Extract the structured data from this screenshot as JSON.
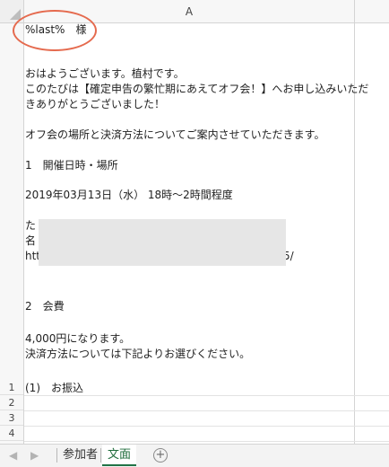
{
  "sheet": {
    "column_header": "A",
    "cell_lines": [
      "%last%　様",
      "おはようございます。植村です。",
      "このたびは【確定申告の繁忙期にあえてオフ会！】へお申し込みいただ",
      "きありがとうございました！",
      "オフ会の場所と決済方法についてご案内させていただきます。",
      "1　開催日時・場所",
      " 2019年03月13日（水） 18時～2時間程度",
      "た",
      "名",
      "htt",
      "5/",
      "2　会費",
      "4,000円になります。",
      "決済方法については下記よりお選びください。",
      "(1)　お振込"
    ],
    "row_numbers": [
      "1",
      "2",
      "3",
      "4"
    ]
  },
  "tabs": {
    "prev_icon": "◀",
    "next_icon": "▶",
    "items": [
      "参加者",
      "文面"
    ],
    "active": "文面",
    "add_icon": "+"
  },
  "colors": {
    "accent": "#217346",
    "annotation": "#e56a4e"
  }
}
